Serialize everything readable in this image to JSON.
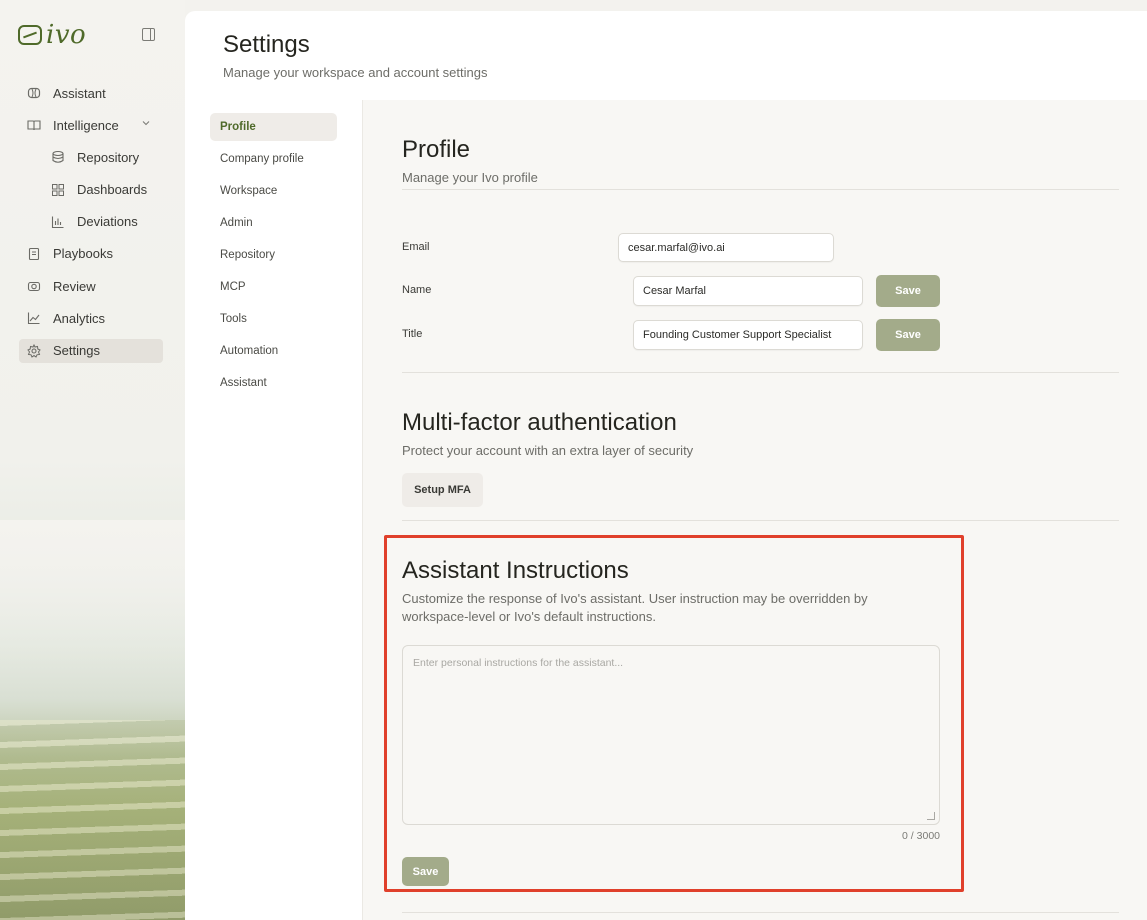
{
  "brand": {
    "logo_text": "ivo"
  },
  "sidebar": {
    "items": [
      {
        "label": "Assistant",
        "icon": "brain-icon"
      },
      {
        "label": "Intelligence",
        "icon": "book-open-icon"
      },
      {
        "label": "Repository",
        "icon": "database-icon"
      },
      {
        "label": "Dashboards",
        "icon": "grid-icon"
      },
      {
        "label": "Deviations",
        "icon": "bar-chart-icon"
      },
      {
        "label": "Playbooks",
        "icon": "notebook-icon"
      },
      {
        "label": "Review",
        "icon": "camera-icon"
      },
      {
        "label": "Analytics",
        "icon": "line-chart-icon"
      },
      {
        "label": "Settings",
        "icon": "gear-icon"
      }
    ]
  },
  "header": {
    "title": "Settings",
    "subtitle": "Manage your workspace and account settings"
  },
  "subnav": {
    "items": [
      "Profile",
      "Company profile",
      "Workspace",
      "Admin",
      "Repository",
      "MCP",
      "Tools",
      "Automation",
      "Assistant"
    ]
  },
  "profile": {
    "title": "Profile",
    "subtitle": "Manage your Ivo profile",
    "email_label": "Email",
    "email_value": "cesar.marfal@ivo.ai",
    "name_label": "Name",
    "name_value": "Cesar Marfal",
    "title_label": "Title",
    "title_value": "Founding Customer Support Specialist",
    "save_label": "Save"
  },
  "mfa": {
    "title": "Multi-factor authentication",
    "subtitle": "Protect your account with an extra layer of security",
    "button_label": "Setup MFA"
  },
  "assistant_instructions": {
    "title": "Assistant Instructions",
    "subtitle": "Customize the response of Ivo's assistant. User instruction may be overridden by workspace-level or Ivo's default instructions.",
    "placeholder": "Enter personal instructions for the assistant...",
    "counter": "0 / 3000",
    "save_label": "Save"
  },
  "colors": {
    "accent_green": "#4f6a2a",
    "save_button": "#a3ab8a",
    "highlight_border": "#e0402b"
  }
}
